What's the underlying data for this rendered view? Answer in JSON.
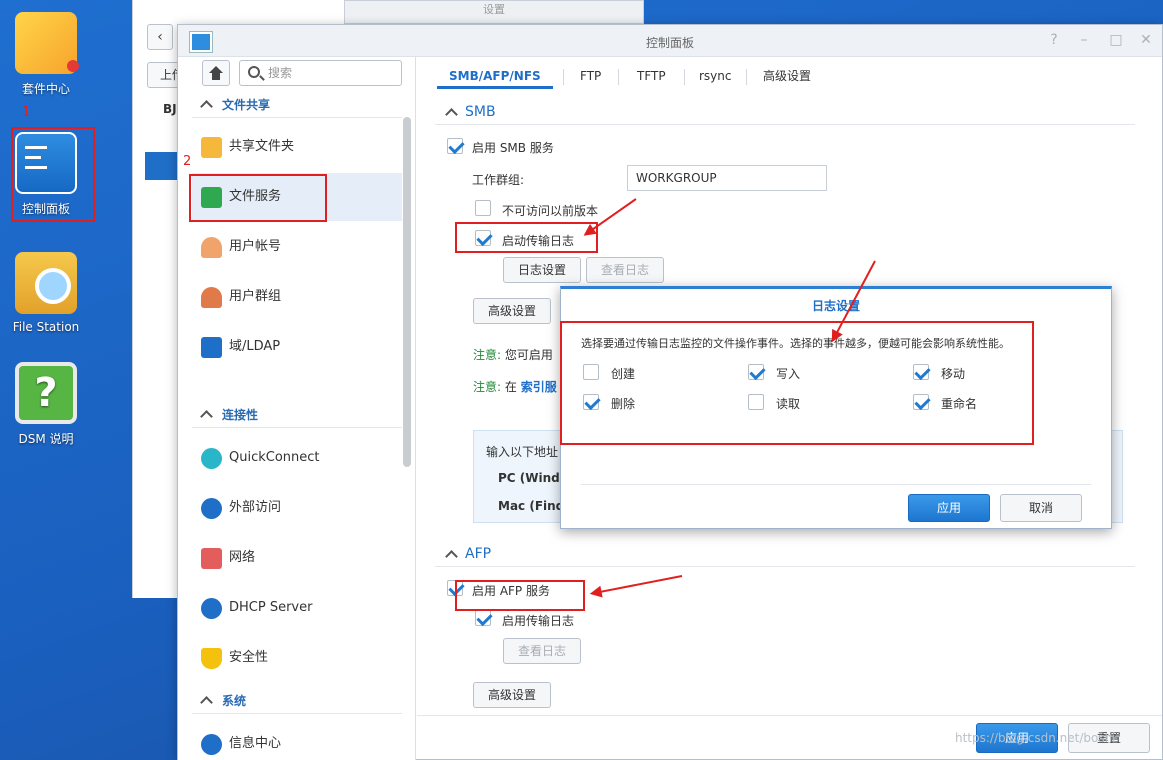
{
  "desktop": {
    "icons": [
      {
        "label": "套件中心"
      },
      {
        "label": "控制面板"
      },
      {
        "label": "File Station"
      },
      {
        "label": "DSM 说明"
      }
    ]
  },
  "bg_window": {
    "title": "设置",
    "upload_label": "上传",
    "tree_root": "BJ"
  },
  "window": {
    "title": "控制面板"
  },
  "sidebar": {
    "search_placeholder": "搜索",
    "sections": [
      {
        "label": "文件共享"
      },
      {
        "label": "连接性"
      },
      {
        "label": "系统"
      }
    ],
    "items": [
      {
        "label": "共享文件夹",
        "icon": "shared-folder-icon"
      },
      {
        "label": "文件服务",
        "icon": "file-services-icon"
      },
      {
        "label": "用户帐号",
        "icon": "user-icon"
      },
      {
        "label": "用户群组",
        "icon": "group-icon"
      },
      {
        "label": "域/LDAP",
        "icon": "domain-icon"
      },
      {
        "label": "QuickConnect",
        "icon": "quickconnect-icon"
      },
      {
        "label": "外部访问",
        "icon": "globe-icon"
      },
      {
        "label": "网络",
        "icon": "network-icon"
      },
      {
        "label": "DHCP Server",
        "icon": "dhcp-icon"
      },
      {
        "label": "安全性",
        "icon": "shield-icon"
      },
      {
        "label": "信息中心",
        "icon": "info-icon"
      }
    ]
  },
  "tabs": [
    {
      "label": "SMB/AFP/NFS"
    },
    {
      "label": "FTP"
    },
    {
      "label": "TFTP"
    },
    {
      "label": "rsync"
    },
    {
      "label": "高级设置"
    }
  ],
  "smb": {
    "title": "SMB",
    "enable_label": "启用 SMB 服务",
    "enable_checked": true,
    "workgroup_label": "工作群组:",
    "workgroup_value": "WORKGROUP",
    "no_prev_versions_label": "不可访问以前版本",
    "no_prev_versions_checked": false,
    "transfer_log_label": "启动传输日志",
    "transfer_log_checked": true,
    "log_settings_button": "日志设置",
    "view_log_button": "查看日志",
    "advanced_button": "高级设置",
    "note1_prefix": "注意:",
    "note1_text": "您可启用",
    "note2_prefix": "注意:",
    "note2_text": "在",
    "note2_link": "索引服",
    "info_lead": "输入以下地址",
    "info_pc": "PC (Wind",
    "info_mac": "Mac (Find"
  },
  "afp": {
    "title": "AFP",
    "enable_label": "启用 AFP 服务",
    "enable_checked": true,
    "transfer_log_label": "启用传输日志",
    "transfer_log_checked": true,
    "view_log_button": "查看日志",
    "advanced_button": "高级设置"
  },
  "dialog": {
    "title": "日志设置",
    "description": "选择要通过传输日志监控的文件操作事件。选择的事件越多，便越可能会影响系统性能。",
    "options": [
      {
        "label": "创建",
        "checked": false
      },
      {
        "label": "写入",
        "checked": true
      },
      {
        "label": "移动",
        "checked": true
      },
      {
        "label": "删除",
        "checked": true
      },
      {
        "label": "读取",
        "checked": false
      },
      {
        "label": "重命名",
        "checked": true
      }
    ],
    "apply_button": "应用",
    "cancel_button": "取消"
  },
  "footer": {
    "apply_button": "应用",
    "reset_button": "重置"
  },
  "annotations": {
    "step1": "1",
    "step2": "2",
    "color": "#e02020"
  },
  "watermark": "https://blog.csdn.net/boshi"
}
